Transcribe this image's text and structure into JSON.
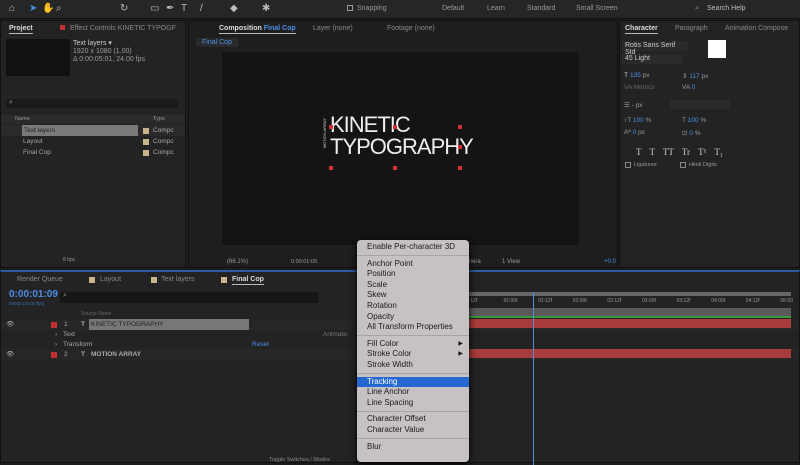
{
  "toolbar": {
    "snapping_label": "Snapping",
    "workspaces": [
      "Default",
      "Learn",
      "Standard",
      "Small Screen"
    ],
    "search_placeholder": "Search Help"
  },
  "project": {
    "tab": "Project",
    "effect_tab": "Effect Controls KINETIC TYPOGF",
    "selected_name": "Text layers ▾",
    "resolution": "1920 x 1080 (1.00)",
    "duration": "Δ 0:00:05:01, 24.00 fps",
    "col_name": "Name",
    "col_type": "Type",
    "items": [
      {
        "name": "Text layers",
        "type": "Compc"
      },
      {
        "name": "Layout",
        "type": "Compc"
      },
      {
        "name": "Final Cop",
        "type": "Compc"
      }
    ],
    "bpc": "8 bpc"
  },
  "composition": {
    "tab_prefix": "Composition",
    "tab_name": "Final Cop",
    "layer_tab": "Layer (none)",
    "footage_tab": "Footage (none)",
    "breadcrumb": "Final Cop",
    "title_line1": "KINETIC",
    "title_line2": "TYPOGRAPHY",
    "side_text": "MOTION ARRAY",
    "zoom": "(66.1%)",
    "timecode": "0:00:01:09",
    "camera": "mera",
    "view": "1 View",
    "exposure": "+0.0"
  },
  "character": {
    "tab": "Character",
    "paragraph_tab": "Paragraph",
    "anim_tab": "Animation Compose",
    "font": "Rotis Sans Serif Std",
    "style": "45 Light",
    "font_size": "135",
    "font_size_unit": "px",
    "leading": "117",
    "leading_unit": "px",
    "kerning": "Metrics",
    "tracking": "0",
    "stroke": "- px",
    "vscale": "100",
    "vscale_unit": "%",
    "hscale": "100",
    "hscale_unit": "%",
    "baseline": "0",
    "baseline_unit": "px",
    "tsume": "0",
    "tsume_unit": "%",
    "styles": [
      "T",
      "T",
      "TT",
      "Tr",
      "T¹",
      "T₁"
    ],
    "ligatures": "Ligatures",
    "hindi": "Hindi Digits"
  },
  "timeline": {
    "tabs": [
      "Render Queue",
      "Layout",
      "Text layers",
      "Final Cop"
    ],
    "timecode": "0:00:01:09",
    "fps": "00033 (24.00 fps)",
    "col_source": "Source Name",
    "layers": [
      {
        "num": "1",
        "name": "KINETIC TYPOGRAPHY"
      },
      {
        "num": "2",
        "name": "MOTION ARRAY"
      }
    ],
    "sub_text": "Text",
    "sub_transform": "Transform",
    "animate": "Animate:",
    "reset": "Reset",
    "ruler": [
      ":12f",
      "01:00f",
      "01:12f",
      "02:00f",
      "02:12f",
      "03:00f",
      "03:12f",
      "04:00f",
      "04:12f",
      "05:00"
    ],
    "toggle": "Toggle Switches / Modes"
  },
  "menu": {
    "items": [
      "Enable Per-character 3D",
      "Anchor Point",
      "Position",
      "Scale",
      "Skew",
      "Rotation",
      "Opacity",
      "All Transform Properties",
      "Fill Color",
      "Stroke Color",
      "Stroke Width",
      "Tracking",
      "Line Anchor",
      "Line Spacing",
      "Character Offset",
      "Character Value",
      "Blur"
    ]
  }
}
